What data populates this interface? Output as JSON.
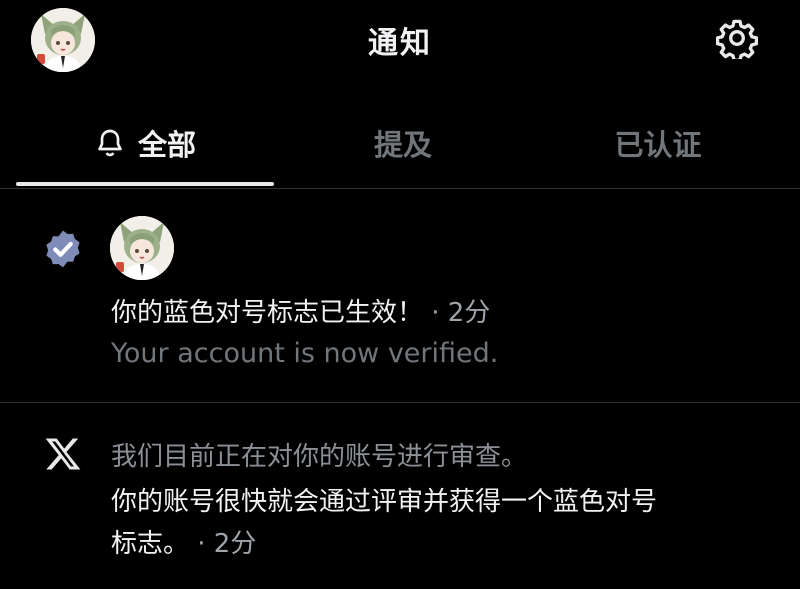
{
  "header": {
    "title": "通知",
    "avatar_icon": "anime-avatar",
    "settings_icon": "gear-icon"
  },
  "tabs": [
    {
      "label": "全部",
      "icon": "bell-icon",
      "active": true
    },
    {
      "label": "提及",
      "active": false
    },
    {
      "label": "已认证",
      "active": false
    }
  ],
  "notifications": [
    {
      "type": "verified",
      "icon": "verified-badge-icon",
      "title": "你的蓝色对号标志已生效！",
      "time": "· 2分",
      "subtitle": "Your account is now verified."
    },
    {
      "type": "x-system",
      "icon": "x-logo-icon",
      "line1": "我们目前正在对你的账号进行审查。",
      "line2": "你的账号很快就会通过评审并获得一个蓝色对号",
      "line3": "标志。",
      "time": "· 2分"
    }
  ],
  "colors": {
    "background": "#000000",
    "text": "#e7e9ea",
    "muted": "#71767b",
    "divider": "#2f3336",
    "verified_badge": "#7f8cb8"
  }
}
